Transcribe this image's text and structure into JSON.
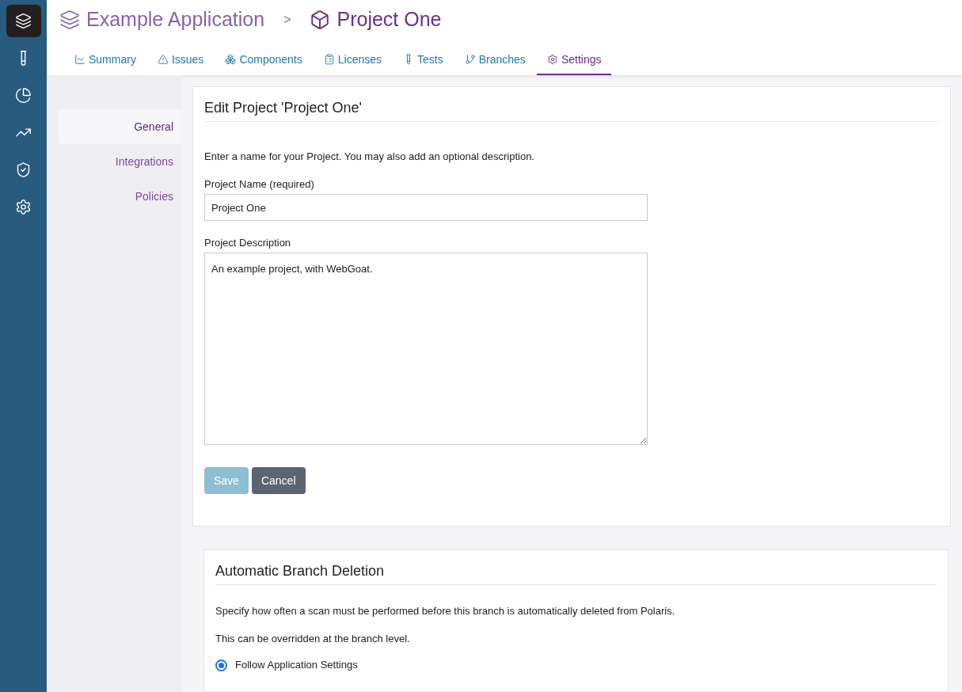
{
  "sidebar": {
    "items": [
      {
        "kind": "layers",
        "selected": true
      },
      {
        "kind": "tube",
        "selected": false
      },
      {
        "kind": "pie",
        "selected": false
      },
      {
        "kind": "trend",
        "selected": false
      },
      {
        "kind": "shield",
        "selected": false
      },
      {
        "kind": "gear",
        "selected": false
      }
    ]
  },
  "breadcrumb": {
    "parent": "Example Application",
    "separator": ">",
    "current": "Project One"
  },
  "tabs": [
    {
      "label": "Summary",
      "kind": "chart",
      "selected": false
    },
    {
      "label": "Issues",
      "kind": "alert",
      "selected": false
    },
    {
      "label": "Components",
      "kind": "boxes",
      "selected": false
    },
    {
      "label": "Licenses",
      "kind": "clipboard",
      "selected": false
    },
    {
      "label": "Tests",
      "kind": "tube",
      "selected": false
    },
    {
      "label": "Branches",
      "kind": "branch",
      "selected": false
    },
    {
      "label": "Settings",
      "kind": "gear",
      "selected": true
    }
  ],
  "settings_nav": [
    {
      "label": "General",
      "selected": true
    },
    {
      "label": "Integrations",
      "selected": false
    },
    {
      "label": "Policies",
      "selected": false
    }
  ],
  "edit_card": {
    "title": "Edit Project 'Project One'",
    "intro": "Enter a name for your Project. You may also add an optional description.",
    "name_label": "Project Name (required)",
    "name_value": "Project One",
    "description_label": "Project Description",
    "description_value": "An example project, with WebGoat.",
    "save": {
      "label": "Save",
      "disabled": true
    },
    "cancel": {
      "label": "Cancel",
      "disabled": false
    }
  },
  "deletion_card": {
    "title": "Automatic Branch Deletion",
    "paragraphs": [
      "Specify how often a scan must be performed before this branch is automatically deleted from Polaris.",
      "This can be overridden at the branch level."
    ],
    "options": [
      {
        "label": "Follow Application Settings",
        "selected": true
      }
    ]
  }
}
